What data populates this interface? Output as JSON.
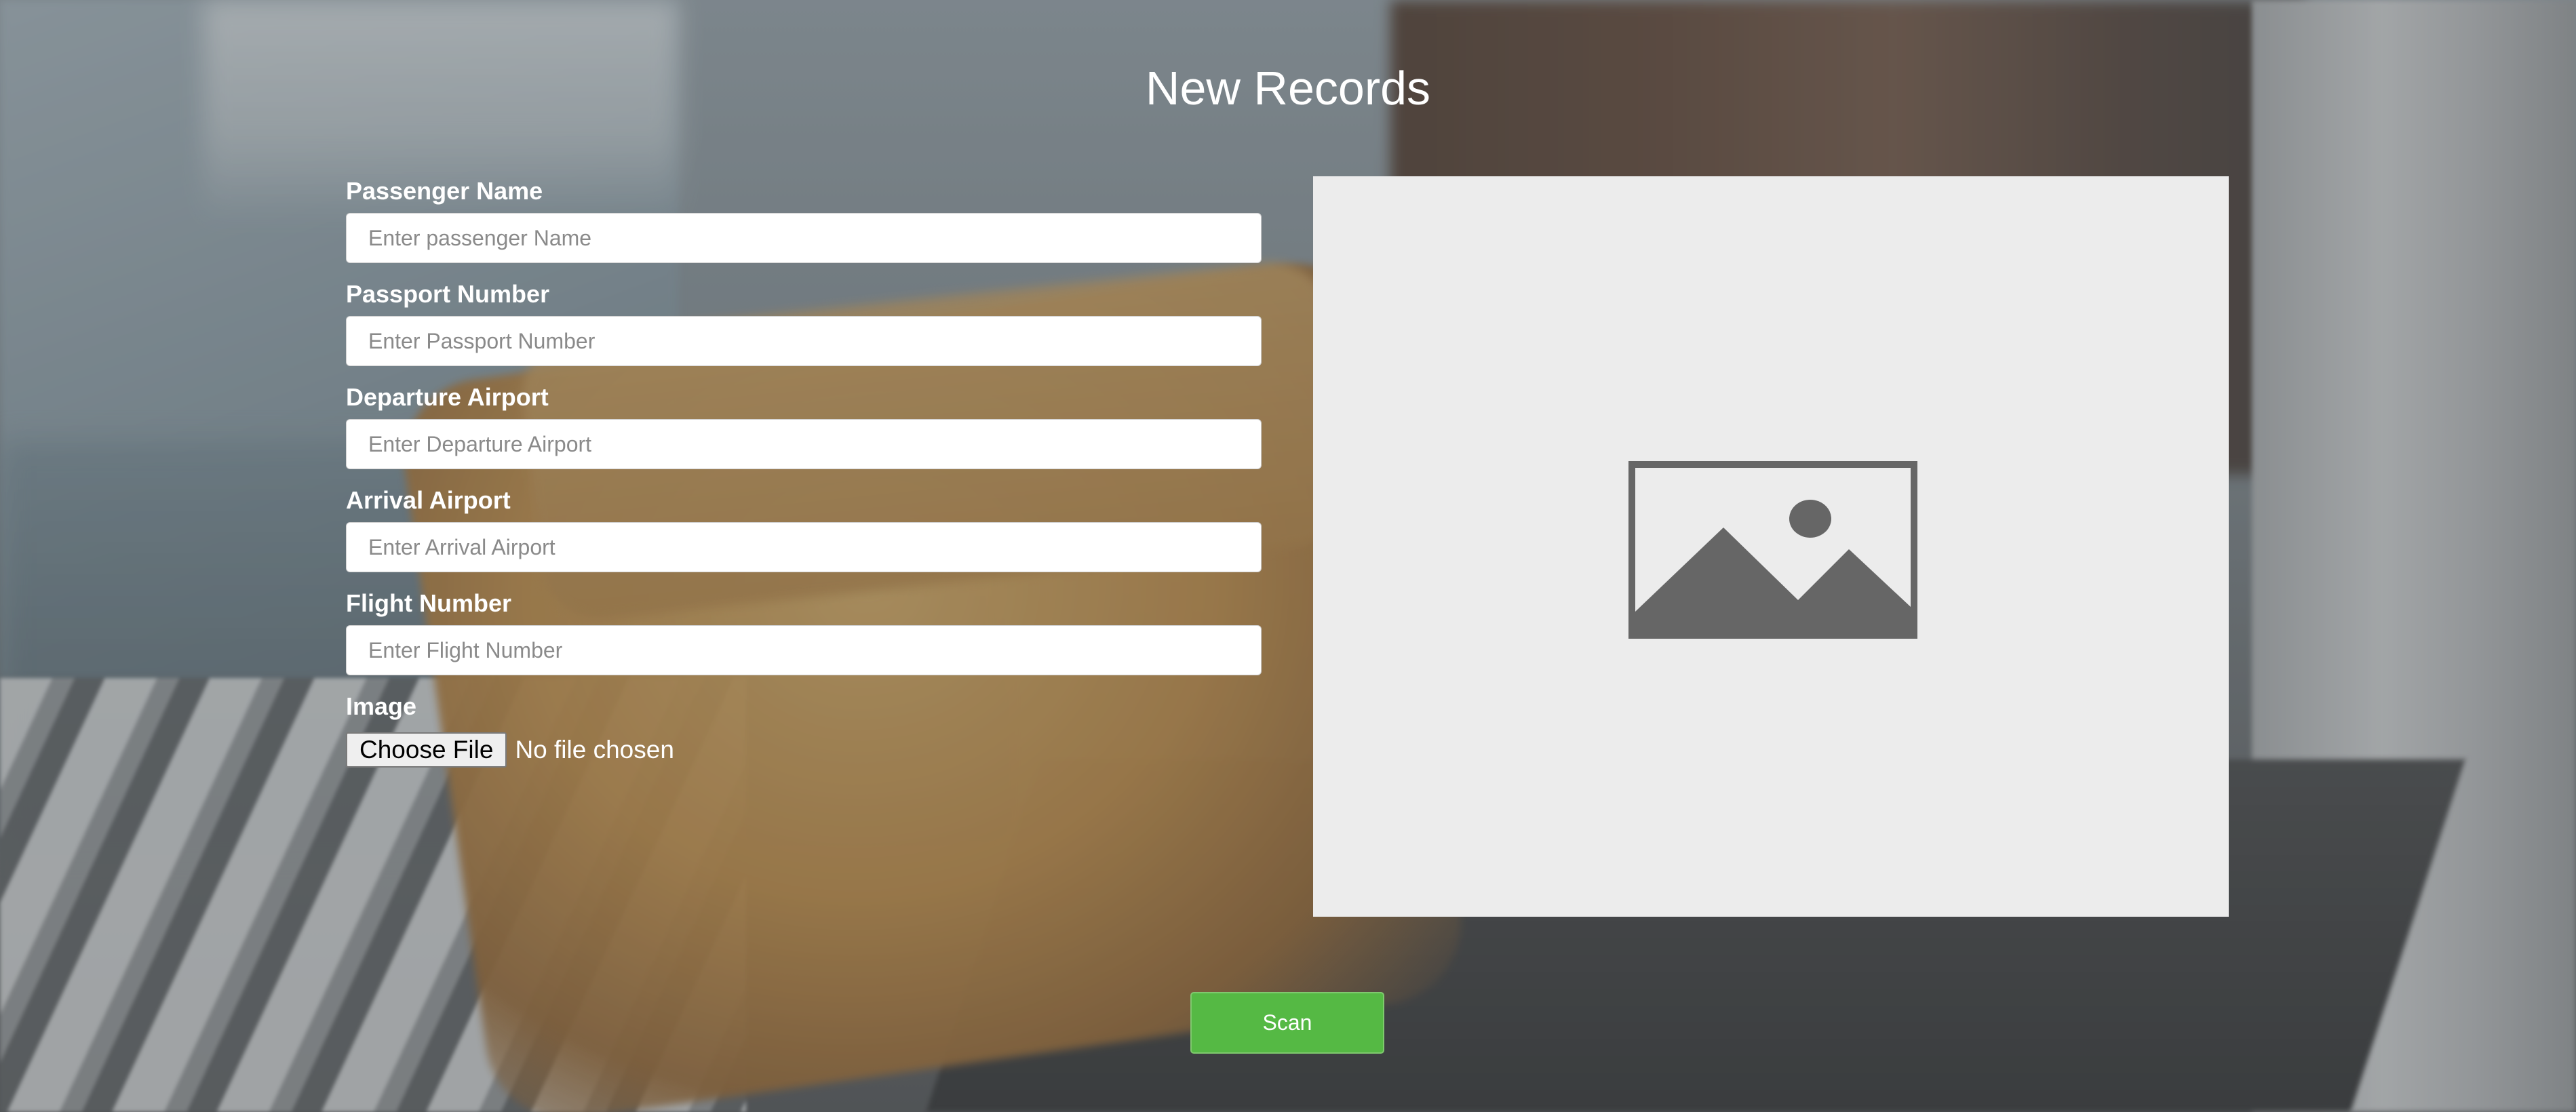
{
  "page": {
    "title": "New Records"
  },
  "form": {
    "passenger_name": {
      "label": "Passenger Name",
      "placeholder": "Enter passenger Name",
      "value": ""
    },
    "passport_number": {
      "label": "Passport Number",
      "placeholder": "Enter Passport Number",
      "value": ""
    },
    "departure_airport": {
      "label": "Departure Airport",
      "placeholder": "Enter Departure Airport",
      "value": ""
    },
    "arrival_airport": {
      "label": "Arrival Airport",
      "placeholder": "Enter Arrival Airport",
      "value": ""
    },
    "flight_number": {
      "label": "Flight Number",
      "placeholder": "Enter Flight Number",
      "value": ""
    },
    "image": {
      "label": "Image",
      "button_label": "Choose File",
      "status": "No file chosen"
    }
  },
  "preview": {
    "icon": "image-placeholder-icon"
  },
  "actions": {
    "scan_label": "Scan"
  },
  "colors": {
    "scan_button": "#55b944",
    "preview_background": "#ececec",
    "placeholder_icon": "#666666",
    "label_text": "#ffffff"
  }
}
